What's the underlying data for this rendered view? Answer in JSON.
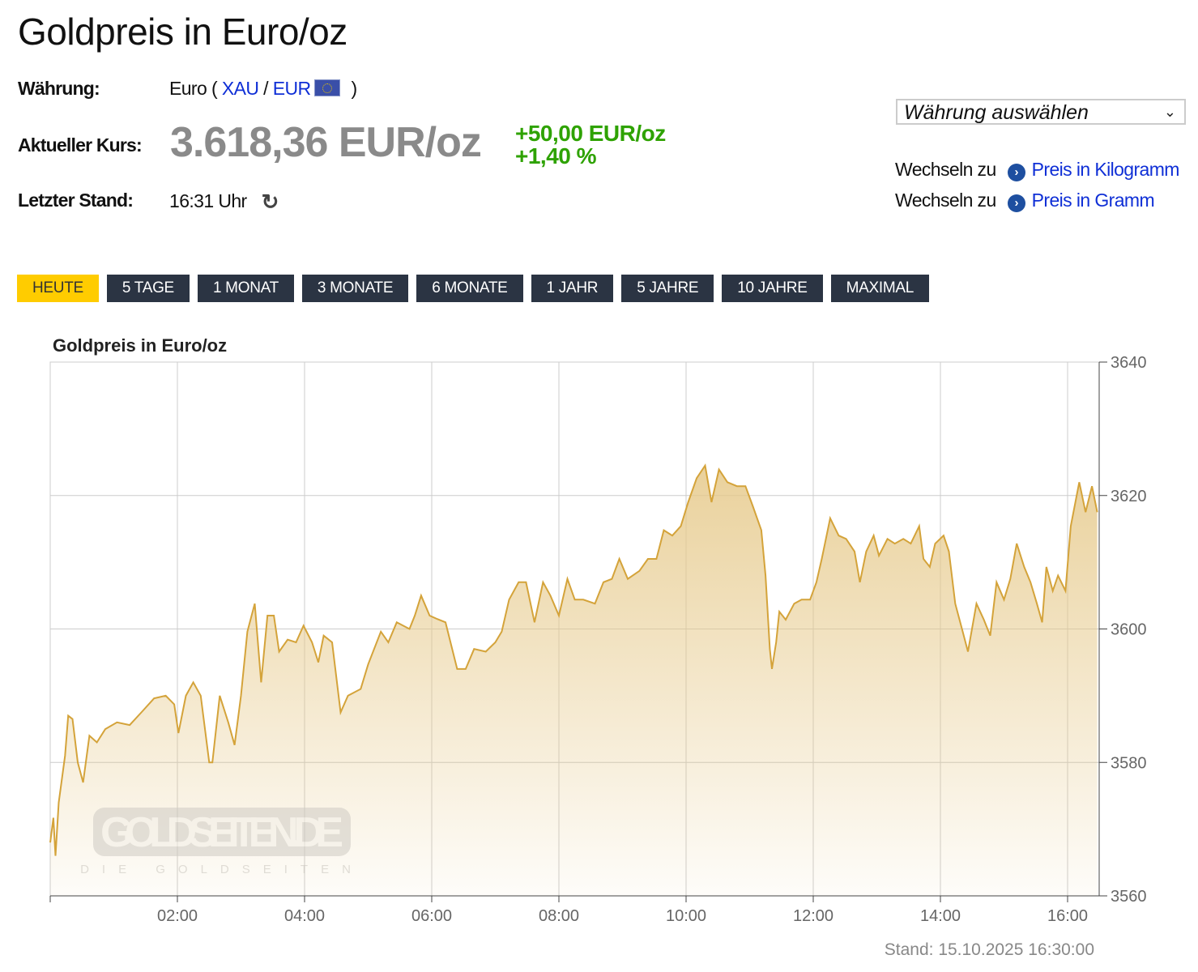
{
  "page": {
    "title": "Goldpreis in Euro/oz",
    "waehrung_label": "Währung:",
    "waehrung_prefix": "Euro (",
    "xau": "XAU",
    "slash": "/",
    "eur": "EUR",
    "waehrung_suffix": ")",
    "kurs_label": "Aktueller Kurs:",
    "kurs_value": "3.618,36 EUR/oz",
    "change_abs": "+50,00 EUR/oz",
    "change_pct": "+1,40 %",
    "stand_label": "Letzter Stand:",
    "stand_value": "16:31 Uhr",
    "refresh_icon": "↻",
    "currency_select": "Währung auswählen",
    "switch": [
      {
        "prefix": "Wechseln zu",
        "link": "Preis in Kilogramm"
      },
      {
        "prefix": "Wechseln zu",
        "link": "Preis in Gramm"
      }
    ],
    "tabs": [
      "HEUTE",
      "5 TAGE",
      "1 MONAT",
      "3 MONATE",
      "6 MONATE",
      "1 JAHR",
      "5 JAHRE",
      "10 JAHRE",
      "MAXIMAL"
    ],
    "active_tab": 0,
    "watermark": "GOLDSEITEN.DE",
    "watermark_sub": "DIE GOLDSEITEN"
  },
  "colors": {
    "line": "#d4a33a",
    "active_tab": "#ffcc00",
    "tab": "#2b3443",
    "positive": "#2ea200",
    "link": "#0f2fd6"
  },
  "chart_data": {
    "type": "area",
    "title": "Goldpreis in Euro/oz",
    "xlabel": "",
    "ylabel": "",
    "x_unit": "minutes since 00:00",
    "xlim": [
      0,
      990
    ],
    "ylim": [
      3560,
      3640
    ],
    "yticks": [
      3560,
      3580,
      3600,
      3620,
      3640
    ],
    "xticks": [
      {
        "m": 120,
        "label": "02:00"
      },
      {
        "m": 240,
        "label": "04:00"
      },
      {
        "m": 360,
        "label": "06:00"
      },
      {
        "m": 480,
        "label": "08:00"
      },
      {
        "m": 600,
        "label": "10:00"
      },
      {
        "m": 720,
        "label": "12:00"
      },
      {
        "m": 840,
        "label": "14:00"
      },
      {
        "m": 960,
        "label": "16:00"
      }
    ],
    "grid": true,
    "footer": "Stand: 15.10.2025 16:30:00",
    "points": [
      [
        0,
        3568
      ],
      [
        3,
        3571.7
      ],
      [
        5,
        3566
      ],
      [
        8,
        3574
      ],
      [
        14,
        3581
      ],
      [
        17,
        3587
      ],
      [
        21,
        3586.5
      ],
      [
        26,
        3580
      ],
      [
        31,
        3577
      ],
      [
        37,
        3584
      ],
      [
        44,
        3583
      ],
      [
        52,
        3585
      ],
      [
        63,
        3586
      ],
      [
        75,
        3585.6
      ],
      [
        86,
        3587.5
      ],
      [
        98,
        3589.6
      ],
      [
        109,
        3590
      ],
      [
        117,
        3588.7
      ],
      [
        121,
        3584.4
      ],
      [
        128,
        3590
      ],
      [
        135,
        3592
      ],
      [
        142,
        3590
      ],
      [
        150,
        3580
      ],
      [
        153,
        3580
      ],
      [
        160,
        3590
      ],
      [
        168,
        3586
      ],
      [
        174,
        3582.6
      ],
      [
        180,
        3590
      ],
      [
        186,
        3599.6
      ],
      [
        193,
        3603.8
      ],
      [
        199,
        3592
      ],
      [
        205,
        3602
      ],
      [
        211,
        3602
      ],
      [
        216,
        3596.6
      ],
      [
        224,
        3598.4
      ],
      [
        232,
        3598
      ],
      [
        239,
        3600.5
      ],
      [
        247,
        3598
      ],
      [
        253,
        3595
      ],
      [
        258,
        3599
      ],
      [
        266,
        3598
      ],
      [
        274,
        3587.5
      ],
      [
        281,
        3590
      ],
      [
        293,
        3591
      ],
      [
        300,
        3594.7
      ],
      [
        312,
        3599.6
      ],
      [
        319,
        3598
      ],
      [
        327,
        3601
      ],
      [
        339,
        3600
      ],
      [
        344,
        3602
      ],
      [
        350,
        3605
      ],
      [
        358,
        3602
      ],
      [
        365,
        3601.5
      ],
      [
        373,
        3601
      ],
      [
        384,
        3594
      ],
      [
        392,
        3594
      ],
      [
        400,
        3597
      ],
      [
        411,
        3596.6
      ],
      [
        420,
        3598
      ],
      [
        426,
        3599.6
      ],
      [
        433,
        3604.4
      ],
      [
        442,
        3607
      ],
      [
        449,
        3607
      ],
      [
        457,
        3601
      ],
      [
        465,
        3607
      ],
      [
        472,
        3605
      ],
      [
        480,
        3602
      ],
      [
        488,
        3607.5
      ],
      [
        495,
        3604.4
      ],
      [
        503,
        3604.4
      ],
      [
        514,
        3603.8
      ],
      [
        522,
        3607
      ],
      [
        530,
        3607.5
      ],
      [
        537,
        3610.5
      ],
      [
        545,
        3607.5
      ],
      [
        556,
        3608.7
      ],
      [
        564,
        3610.5
      ],
      [
        572,
        3610.5
      ],
      [
        579,
        3614.8
      ],
      [
        587,
        3614
      ],
      [
        595,
        3615.4
      ],
      [
        602,
        3619
      ],
      [
        610,
        3622.6
      ],
      [
        618,
        3624.5
      ],
      [
        624,
        3619
      ],
      [
        631,
        3623.9
      ],
      [
        639,
        3622
      ],
      [
        648,
        3621.4
      ],
      [
        656,
        3621.4
      ],
      [
        663,
        3618.4
      ],
      [
        671,
        3614.8
      ],
      [
        675,
        3608
      ],
      [
        679,
        3597
      ],
      [
        681,
        3594
      ],
      [
        685,
        3598
      ],
      [
        688,
        3602.6
      ],
      [
        694,
        3601.4
      ],
      [
        702,
        3603.8
      ],
      [
        709,
        3604.4
      ],
      [
        717,
        3604.4
      ],
      [
        723,
        3607
      ],
      [
        728,
        3610.5
      ],
      [
        736,
        3616.6
      ],
      [
        744,
        3614
      ],
      [
        751,
        3613.5
      ],
      [
        759,
        3611.6
      ],
      [
        764,
        3607
      ],
      [
        770,
        3611.6
      ],
      [
        777,
        3614
      ],
      [
        782,
        3611
      ],
      [
        790,
        3613.5
      ],
      [
        797,
        3612.8
      ],
      [
        805,
        3613.5
      ],
      [
        812,
        3612.8
      ],
      [
        820,
        3615.4
      ],
      [
        824,
        3610.5
      ],
      [
        830,
        3609.3
      ],
      [
        835,
        3612.8
      ],
      [
        843,
        3614
      ],
      [
        848,
        3611.6
      ],
      [
        854,
        3603.8
      ],
      [
        861,
        3599.6
      ],
      [
        866,
        3596.6
      ],
      [
        874,
        3603.8
      ],
      [
        881,
        3601.4
      ],
      [
        887,
        3599
      ],
      [
        893,
        3607
      ],
      [
        900,
        3604.4
      ],
      [
        906,
        3607.5
      ],
      [
        912,
        3612.8
      ],
      [
        919,
        3609.3
      ],
      [
        925,
        3607
      ],
      [
        931,
        3603.8
      ],
      [
        936,
        3601
      ],
      [
        940,
        3609.3
      ],
      [
        946,
        3605.7
      ],
      [
        951,
        3608
      ],
      [
        958,
        3605.7
      ],
      [
        963,
        3615.4
      ],
      [
        971,
        3622
      ],
      [
        977,
        3617.5
      ],
      [
        983,
        3621.4
      ],
      [
        988,
        3617.5
      ]
    ]
  }
}
